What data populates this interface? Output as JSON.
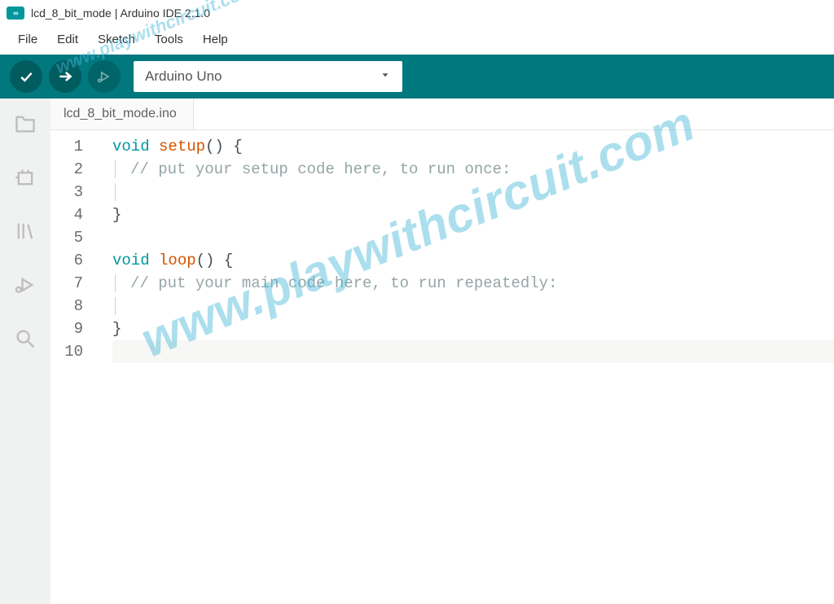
{
  "titlebar": {
    "app_icon_text": "∞",
    "text": "lcd_8_bit_mode | Arduino IDE 2.1.0"
  },
  "menubar": {
    "items": [
      "File",
      "Edit",
      "Sketch",
      "Tools",
      "Help"
    ]
  },
  "toolbar": {
    "board_selected": "Arduino Uno"
  },
  "tab": {
    "filename": "lcd_8_bit_mode.ino"
  },
  "code": {
    "lines": [
      {
        "n": "1",
        "tokens": [
          {
            "t": "void ",
            "c": "kw"
          },
          {
            "t": "setup",
            "c": "fn"
          },
          {
            "t": "() {",
            "c": "pn"
          }
        ]
      },
      {
        "n": "2",
        "indent": true,
        "tokens": [
          {
            "t": "// put your setup code here, to run once:",
            "c": "cm"
          }
        ]
      },
      {
        "n": "3",
        "indent": true,
        "tokens": []
      },
      {
        "n": "4",
        "tokens": [
          {
            "t": "}",
            "c": "pn"
          }
        ]
      },
      {
        "n": "5",
        "tokens": []
      },
      {
        "n": "6",
        "tokens": [
          {
            "t": "void ",
            "c": "kw"
          },
          {
            "t": "loop",
            "c": "fn"
          },
          {
            "t": "() {",
            "c": "pn"
          }
        ]
      },
      {
        "n": "7",
        "indent": true,
        "tokens": [
          {
            "t": "// put your main code here, to run repeatedly:",
            "c": "cm"
          }
        ]
      },
      {
        "n": "8",
        "indent": true,
        "tokens": []
      },
      {
        "n": "9",
        "tokens": [
          {
            "t": "}",
            "c": "pn"
          }
        ]
      },
      {
        "n": "10",
        "current": true,
        "tokens": []
      }
    ]
  },
  "watermark": {
    "text": "www.playwithcircuit.com"
  },
  "colors": {
    "accent": "#00787e",
    "teal_light": "#00979d",
    "orange": "#d35400",
    "comment": "#95a5a6"
  }
}
